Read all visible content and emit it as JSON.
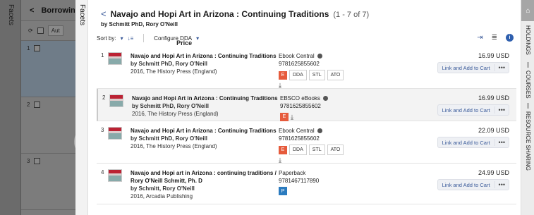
{
  "left_panel": {
    "facets_label": "Facets",
    "header_title": "Borrowing",
    "header_icon": "chevron-left-icon",
    "toolbar_button": "Aut",
    "rows": [
      "1",
      "2",
      "3"
    ]
  },
  "facets_tab": {
    "label": "Facets"
  },
  "main": {
    "title": "Navajo and Hopi Art in Arizona : Continuing Traditions",
    "count": "(1 - 7 of 7)",
    "subtitle": "by Schmitt PhD, Rory O'Neill",
    "sort_label": "Sort by:",
    "sort_value": "Price",
    "configure": "Configure DDA"
  },
  "results": [
    {
      "index": "1",
      "title": "Navajo and Hopi Art in Arizona : Continuing Traditions",
      "author": "by Schmitt PhD, Rory O'Neill",
      "pub": "2016, The History Press (England)",
      "vendor": "Ebook Central",
      "isbn": "9781625855602",
      "price": "16.99 USD",
      "cart_label": "Link and Add to Cart",
      "tags": [
        "E",
        "DDA",
        "STL",
        "ATO"
      ]
    },
    {
      "index": "2",
      "title": "Navajo and Hopi Art in Arizona : Continuing Traditions",
      "author": "by Schmitt PhD, Rory O'Neill",
      "pub": "2016, The History Press (England)",
      "vendor": "EBSCO eBooks",
      "isbn": "9781625855602",
      "price": "16.99 USD",
      "cart_label": "Link and Add to Cart",
      "tags": [
        "E"
      ]
    },
    {
      "index": "3",
      "title": "Navajo and Hopi Art in Arizona : Continuing Traditions",
      "author": "by Schmitt PhD, Rory O'Neill",
      "pub": "2016, The History Press (England)",
      "vendor": "Ebook Central",
      "isbn": "9781625855602",
      "price": "22.09 USD",
      "cart_label": "Link and Add to Cart",
      "tags": [
        "E",
        "DDA",
        "STL",
        "ATO"
      ]
    },
    {
      "index": "4",
      "title": "Navajo and Hopi art in Arizona : continuing traditions / Rory O'Neill Schmitt, Ph. D",
      "author": "by Schmitt, Rory O'Neill",
      "pub": "2016, Arcadia Publishing",
      "vendor": "Paperback",
      "isbn": "9781467117890",
      "price": "24.99 USD",
      "cart_label": "Link and Add to Cart",
      "tags": [
        "P"
      ]
    }
  ],
  "right_sidebar": {
    "items": [
      "HOLDINGS",
      "COURSES",
      "RESOURCE SHARING"
    ]
  },
  "colors": {
    "accent": "#3b5b9a",
    "ebook_badge": "#e65b3c",
    "print_badge": "#2b7bbf"
  }
}
